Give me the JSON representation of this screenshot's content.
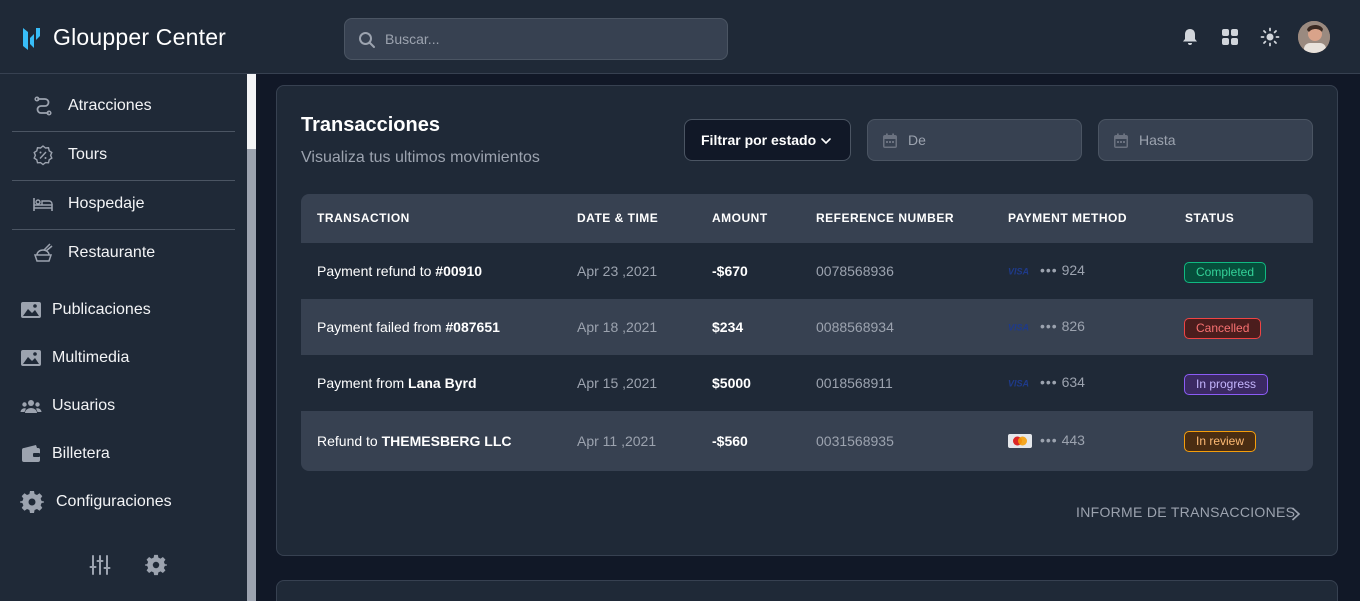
{
  "header": {
    "brand": "Gloupper Center",
    "search_placeholder": "Buscar...",
    "icons": [
      "bell-icon",
      "apps-grid-icon",
      "sun-icon",
      "avatar"
    ]
  },
  "sidebar": {
    "sub_items": [
      {
        "label": "Atracciones",
        "icon": "path-icon"
      },
      {
        "label": "Tours",
        "icon": "badge-percent-icon"
      },
      {
        "label": "Hospedaje",
        "icon": "bed-icon"
      },
      {
        "label": "Restaurante",
        "icon": "food-icon"
      }
    ],
    "items": [
      {
        "label": "Publicaciones",
        "icon": "image-icon"
      },
      {
        "label": "Multimedia",
        "icon": "image-icon"
      },
      {
        "label": "Usuarios",
        "icon": "users-icon"
      },
      {
        "label": "Billetera",
        "icon": "wallet-icon"
      },
      {
        "label": "Configuraciones",
        "icon": "gear-icon"
      }
    ],
    "footer_icons": [
      "sliders-icon",
      "gear-icon"
    ]
  },
  "transactions": {
    "title": "Transacciones",
    "subtitle": "Visualiza tus ultimos movimientos",
    "filter_label": "Filtrar por estado",
    "date_from_placeholder": "De",
    "date_to_placeholder": "Hasta",
    "columns": [
      "TRANSACTION",
      "DATE & TIME",
      "AMOUNT",
      "REFERENCE NUMBER",
      "PAYMENT METHOD",
      "STATUS"
    ],
    "rows": [
      {
        "prefix": "Payment refund to ",
        "target": "#00910",
        "date": "Apr 23 ,2021",
        "amount": "-$670",
        "reference": "0078568936",
        "card": "visa",
        "digits": "924",
        "status": "Completed"
      },
      {
        "prefix": "Payment failed from ",
        "target": "#087651",
        "date": "Apr 18 ,2021",
        "amount": "$234",
        "reference": "0088568934",
        "card": "visa",
        "digits": "826",
        "status": "Cancelled"
      },
      {
        "prefix": "Payment from ",
        "target": "Lana Byrd",
        "date": "Apr 15 ,2021",
        "amount": "$5000",
        "reference": "0018568911",
        "card": "visa",
        "digits": "634",
        "status": "In progress"
      },
      {
        "prefix": "Refund to ",
        "target": "THEMESBERG LLC",
        "date": "Apr 11 ,2021",
        "amount": "-$560",
        "reference": "0031568935",
        "card": "mastercard",
        "digits": "443",
        "status": "In review"
      }
    ],
    "dots": "•••",
    "report_link": "INFORME DE TRANSACCIONES"
  },
  "colors": {
    "page_bg": "#111827",
    "panel_bg": "#1f2937",
    "row_alt_bg": "#374151",
    "completed": "#34d399",
    "cancelled": "#f87171",
    "in_progress": "#c4b5fd",
    "in_review": "#fdba74"
  }
}
